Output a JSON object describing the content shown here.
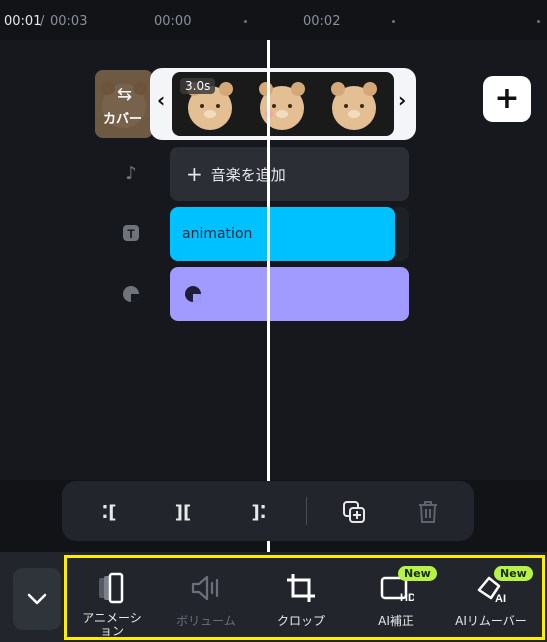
{
  "ruler": {
    "current_time": "00:01",
    "separator": "/",
    "total_time": "00:03",
    "tick_0": "00:00",
    "tick_2": "00:02"
  },
  "cover": {
    "label": "カバー"
  },
  "clip": {
    "duration": "3.0s",
    "handle_left": "‹",
    "handle_right": "›"
  },
  "add_clip": {
    "symbol": "+"
  },
  "music": {
    "plus": "+",
    "label": "音楽を追加"
  },
  "text_track": {
    "label": "animation"
  },
  "edit_toolbar": {
    "split_left": "⁚[",
    "split_mid": "][",
    "split_right": "]⁚"
  },
  "tools": [
    {
      "label": "アニメーション",
      "icon": "animation-icon",
      "enabled": true
    },
    {
      "label": "ボリューム",
      "icon": "volume-icon",
      "enabled": false
    },
    {
      "label": "クロップ",
      "icon": "crop-icon",
      "enabled": true
    },
    {
      "label": "AI補正",
      "icon": "ai-enhance-icon",
      "enabled": true,
      "badge": "New"
    },
    {
      "label": "AIリムーバー",
      "icon": "ai-remover-icon",
      "enabled": true,
      "badge": "New"
    }
  ],
  "colors": {
    "accent_highlight": "#ffee00",
    "text_track": "#00c1ff",
    "sticker_track": "#a29bff",
    "new_badge": "#b7f246"
  }
}
